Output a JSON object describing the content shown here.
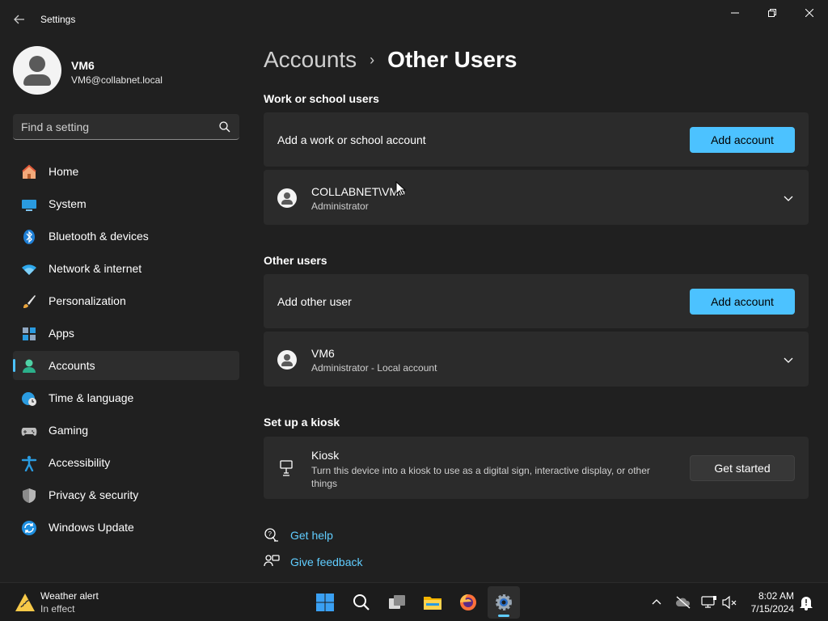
{
  "window": {
    "title": "Settings",
    "controls": {
      "minimize": "—",
      "maximize": "❐",
      "close": "✕"
    }
  },
  "profile": {
    "name": "VM6",
    "email": "VM6@collabnet.local"
  },
  "search": {
    "placeholder": "Find a setting"
  },
  "sidebar": {
    "items": [
      {
        "label": "Home",
        "icon": "home-icon",
        "active": false
      },
      {
        "label": "System",
        "icon": "system-icon",
        "active": false
      },
      {
        "label": "Bluetooth & devices",
        "icon": "bluetooth-icon",
        "active": false
      },
      {
        "label": "Network & internet",
        "icon": "wifi-icon",
        "active": false
      },
      {
        "label": "Personalization",
        "icon": "brush-icon",
        "active": false
      },
      {
        "label": "Apps",
        "icon": "apps-icon",
        "active": false
      },
      {
        "label": "Accounts",
        "icon": "accounts-icon",
        "active": true
      },
      {
        "label": "Time & language",
        "icon": "globe-clock-icon",
        "active": false
      },
      {
        "label": "Gaming",
        "icon": "gamepad-icon",
        "active": false
      },
      {
        "label": "Accessibility",
        "icon": "accessibility-icon",
        "active": false
      },
      {
        "label": "Privacy & security",
        "icon": "shield-icon",
        "active": false
      },
      {
        "label": "Windows Update",
        "icon": "update-icon",
        "active": false
      }
    ]
  },
  "breadcrumb": {
    "parent": "Accounts",
    "separator": "›",
    "current": "Other Users"
  },
  "work_school": {
    "heading": "Work or school users",
    "add_label": "Add a work or school account",
    "add_button": "Add account",
    "user": {
      "name": "COLLABNET\\VM6",
      "role": "Administrator"
    }
  },
  "other_users": {
    "heading": "Other users",
    "add_label": "Add other user",
    "add_button": "Add account",
    "user": {
      "name": "VM6",
      "role": "Administrator - Local account"
    }
  },
  "kiosk": {
    "heading": "Set up a kiosk",
    "title": "Kiosk",
    "description": "Turn this device into a kiosk to use as a digital sign, interactive display, or other things",
    "button": "Get started"
  },
  "links": {
    "help": "Get help",
    "feedback": "Give feedback"
  },
  "taskbar": {
    "weather_title": "Weather alert",
    "weather_sub": "In effect",
    "time": "8:02 AM",
    "date": "7/15/2024"
  },
  "colors": {
    "accent": "#4cc2ff",
    "background": "#202020",
    "card": "#2b2b2b",
    "link": "#60cdff"
  }
}
